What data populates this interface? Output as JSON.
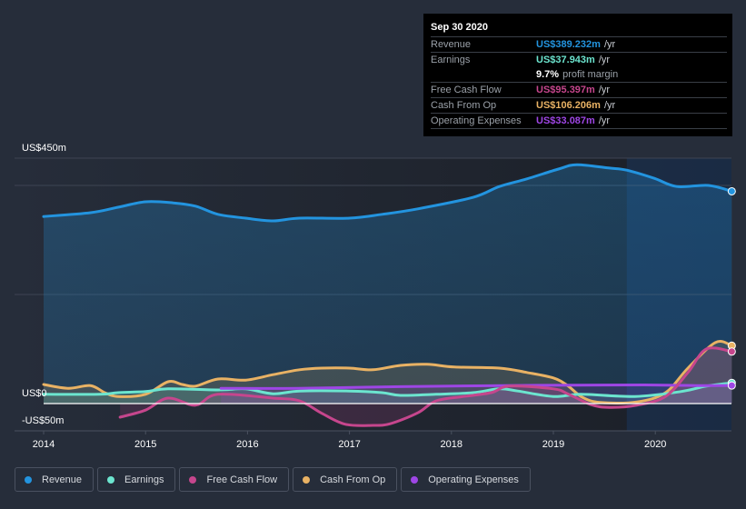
{
  "tooltip": {
    "date": "Sep 30 2020",
    "rows": [
      {
        "label": "Revenue",
        "value": "US$389.232m",
        "unit": "/yr",
        "color": "#2394df"
      },
      {
        "label": "Earnings",
        "value": "US$37.943m",
        "unit": "/yr",
        "color": "#6ce5cf"
      },
      {
        "label": "",
        "margin_value": "9.7%",
        "margin_text": "profit margin"
      },
      {
        "label": "Free Cash Flow",
        "value": "US$95.397m",
        "unit": "/yr",
        "color": "#c6468d"
      },
      {
        "label": "Cash From Op",
        "value": "US$106.206m",
        "unit": "/yr",
        "color": "#e9b264"
      },
      {
        "label": "Operating Expenses",
        "value": "US$33.087m",
        "unit": "/yr",
        "color": "#9e46e5"
      }
    ]
  },
  "legend": [
    {
      "label": "Revenue",
      "color": "#2394df"
    },
    {
      "label": "Earnings",
      "color": "#6ce5cf"
    },
    {
      "label": "Free Cash Flow",
      "color": "#c6468d"
    },
    {
      "label": "Cash From Op",
      "color": "#e9b264"
    },
    {
      "label": "Operating Expenses",
      "color": "#9e46e5"
    }
  ],
  "chart_data": {
    "type": "line",
    "title": "",
    "xlabel": "",
    "ylabel": "",
    "y_tick_labels": [
      {
        "value": 450,
        "label": "US$450m"
      },
      {
        "value": 0,
        "label": "US$0"
      },
      {
        "value": -50,
        "label": "-US$50m"
      }
    ],
    "ylim": [
      -50,
      450
    ],
    "gridlines_at": [
      450,
      400,
      200,
      0
    ],
    "xlim": [
      2014.0,
      2020.75
    ],
    "x_ticks": [
      2014,
      2015,
      2016,
      2017,
      2018,
      2019,
      2020
    ],
    "x_tick_labels": [
      "2014",
      "2015",
      "2016",
      "2017",
      "2018",
      "2019",
      "2020"
    ],
    "forecast_shade_start": 2019.72,
    "units": "US$ millions per year",
    "series": [
      {
        "name": "Revenue",
        "color": "#2394df",
        "area": true,
        "points": [
          [
            2014.0,
            343
          ],
          [
            2014.46,
            350
          ],
          [
            2014.73,
            360
          ],
          [
            2015.0,
            370
          ],
          [
            2015.27,
            368
          ],
          [
            2015.49,
            362
          ],
          [
            2015.71,
            347
          ],
          [
            2015.98,
            340
          ],
          [
            2016.25,
            335
          ],
          [
            2016.51,
            340
          ],
          [
            2017.0,
            340
          ],
          [
            2017.32,
            347
          ],
          [
            2017.67,
            357
          ],
          [
            2018.21,
            378
          ],
          [
            2018.47,
            398
          ],
          [
            2018.74,
            412
          ],
          [
            2019.05,
            430
          ],
          [
            2019.23,
            438
          ],
          [
            2019.54,
            432
          ],
          [
            2019.72,
            428
          ],
          [
            2019.99,
            413
          ],
          [
            2020.21,
            398
          ],
          [
            2020.52,
            400
          ],
          [
            2020.75,
            389.232
          ]
        ]
      },
      {
        "name": "Earnings",
        "color": "#6ce5cf",
        "area": true,
        "points": [
          [
            2014.0,
            17
          ],
          [
            2014.55,
            17
          ],
          [
            2014.73,
            20
          ],
          [
            2015.0,
            22
          ],
          [
            2015.22,
            27
          ],
          [
            2015.71,
            25
          ],
          [
            2015.98,
            27
          ],
          [
            2016.25,
            18
          ],
          [
            2016.51,
            23
          ],
          [
            2017.0,
            23
          ],
          [
            2017.32,
            20
          ],
          [
            2017.5,
            15
          ],
          [
            2017.85,
            17
          ],
          [
            2018.21,
            20
          ],
          [
            2018.47,
            27
          ],
          [
            2018.65,
            23
          ],
          [
            2019.0,
            13
          ],
          [
            2019.27,
            17
          ],
          [
            2019.8,
            13
          ],
          [
            2020.25,
            22
          ],
          [
            2020.5,
            32
          ],
          [
            2020.75,
            37.943
          ]
        ]
      },
      {
        "name": "Free Cash Flow",
        "color": "#c6468d",
        "area": true,
        "points": [
          [
            2014.75,
            -25
          ],
          [
            2015.0,
            -12
          ],
          [
            2015.22,
            10
          ],
          [
            2015.49,
            -3
          ],
          [
            2015.71,
            17
          ],
          [
            2016.25,
            10
          ],
          [
            2016.51,
            5
          ],
          [
            2016.73,
            -18
          ],
          [
            2016.96,
            -38
          ],
          [
            2017.23,
            -40
          ],
          [
            2017.4,
            -37
          ],
          [
            2017.67,
            -17
          ],
          [
            2017.85,
            5
          ],
          [
            2018.12,
            13
          ],
          [
            2018.39,
            20
          ],
          [
            2018.57,
            32
          ],
          [
            2019.0,
            27
          ],
          [
            2019.14,
            18
          ],
          [
            2019.37,
            -2
          ],
          [
            2019.55,
            -7
          ],
          [
            2019.82,
            -3
          ],
          [
            2020.1,
            13
          ],
          [
            2020.32,
            57
          ],
          [
            2020.5,
            100
          ],
          [
            2020.75,
            95.397
          ]
        ]
      },
      {
        "name": "Cash From Op",
        "color": "#e9b264",
        "area": true,
        "points": [
          [
            2014.0,
            35
          ],
          [
            2014.24,
            28
          ],
          [
            2014.46,
            33
          ],
          [
            2014.6,
            20
          ],
          [
            2014.73,
            13
          ],
          [
            2015.0,
            17
          ],
          [
            2015.22,
            40
          ],
          [
            2015.36,
            35
          ],
          [
            2015.49,
            32
          ],
          [
            2015.71,
            45
          ],
          [
            2015.98,
            43
          ],
          [
            2016.25,
            53
          ],
          [
            2016.51,
            62
          ],
          [
            2016.73,
            65
          ],
          [
            2017.0,
            65
          ],
          [
            2017.23,
            62
          ],
          [
            2017.5,
            70
          ],
          [
            2017.76,
            72
          ],
          [
            2018.03,
            67
          ],
          [
            2018.47,
            65
          ],
          [
            2018.74,
            57
          ],
          [
            2019.0,
            47
          ],
          [
            2019.14,
            33
          ],
          [
            2019.28,
            12
          ],
          [
            2019.46,
            2
          ],
          [
            2019.82,
            3
          ],
          [
            2020.1,
            20
          ],
          [
            2020.32,
            65
          ],
          [
            2020.59,
            112
          ],
          [
            2020.75,
            106.206
          ]
        ]
      },
      {
        "name": "Operating Expenses",
        "color": "#9e46e5",
        "area": true,
        "points": [
          [
            2015.74,
            28
          ],
          [
            2016.5,
            28
          ],
          [
            2017.5,
            31
          ],
          [
            2018.5,
            33
          ],
          [
            2019.5,
            34
          ],
          [
            2020.0,
            34
          ],
          [
            2020.4,
            33
          ],
          [
            2020.75,
            33.087
          ]
        ]
      }
    ]
  }
}
